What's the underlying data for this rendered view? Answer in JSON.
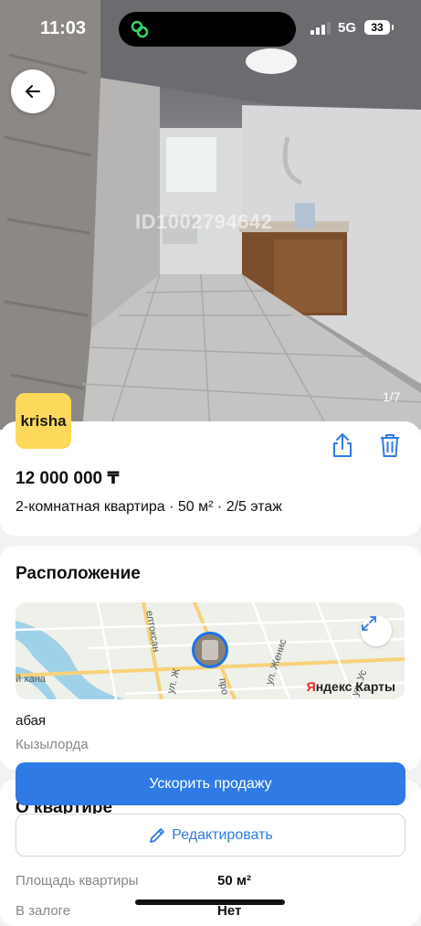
{
  "status_bar": {
    "time": "11:03",
    "network": "5G",
    "battery": "33"
  },
  "photo": {
    "watermark": "ID1002794642",
    "counter": "1/7"
  },
  "listing": {
    "logo_text": "krisha",
    "price": "12 000 000 ₸",
    "subtitle": "2-комнатная квартира · 50 м² · 2/5 этаж"
  },
  "location": {
    "title": "Расположение",
    "map_labels": [
      "елтоксан",
      "ул. Женис",
      "й хана",
      "ул. Ж",
      "про",
      "ул. Ус"
    ],
    "map_brand_first": "Я",
    "map_brand_rest": "ндекс Карты",
    "street": "абая",
    "city": "Кызылорда"
  },
  "about": {
    "title": "О квартире",
    "rows": [
      {
        "label": "Площадь квартиры",
        "value": "50 м²"
      },
      {
        "label": "В залоге",
        "value": "Нет"
      }
    ]
  },
  "actions": {
    "boost_label": "Ускорить продажу",
    "edit_label": "Редактировать"
  },
  "colors": {
    "accent": "#2f7ae5",
    "logo_bg": "#fdd95b"
  }
}
